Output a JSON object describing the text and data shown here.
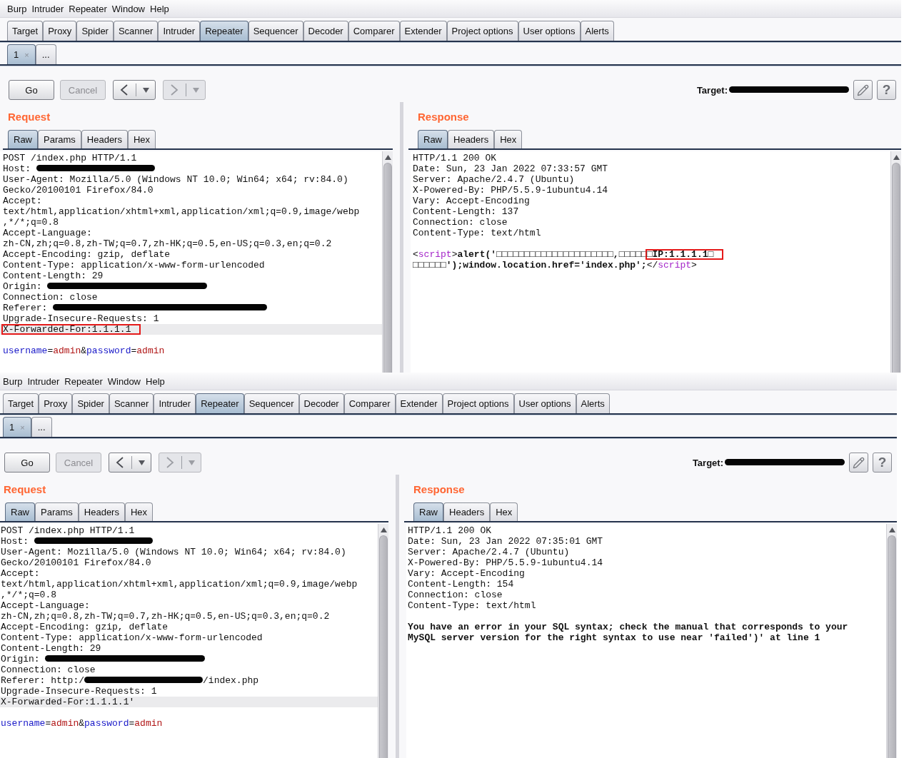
{
  "windows": [
    {
      "menu": [
        "Burp",
        "Intruder",
        "Repeater",
        "Window",
        "Help"
      ],
      "tabs": [
        {
          "label": "Target",
          "selected": false
        },
        {
          "label": "Proxy",
          "selected": false
        },
        {
          "label": "Spider",
          "selected": false
        },
        {
          "label": "Scanner",
          "selected": false
        },
        {
          "label": "Intruder",
          "selected": false
        },
        {
          "label": "Repeater",
          "selected": true
        },
        {
          "label": "Sequencer",
          "selected": false
        },
        {
          "label": "Decoder",
          "selected": false
        },
        {
          "label": "Comparer",
          "selected": false
        },
        {
          "label": "Extender",
          "selected": false
        },
        {
          "label": "Project options",
          "selected": false
        },
        {
          "label": "User options",
          "selected": false
        },
        {
          "label": "Alerts",
          "selected": false
        }
      ],
      "repeater_tabs": [
        {
          "label": "1",
          "close": "×",
          "selected": true
        },
        {
          "label": "...",
          "selected": false
        }
      ],
      "toolbar": {
        "buttons": [
          {
            "kind": "text",
            "label": "Go",
            "disabled": false
          },
          {
            "kind": "text",
            "label": "Cancel",
            "disabled": true
          },
          {
            "kind": "back",
            "disabled": false
          },
          {
            "kind": "forward",
            "disabled": true
          }
        ],
        "target": {
          "label": "Target:",
          "redacted": true
        },
        "help": "?"
      },
      "request": {
        "title": "Request",
        "tabs": [
          {
            "label": "Raw",
            "selected": true
          },
          {
            "label": "Params",
            "selected": false
          },
          {
            "label": "Headers",
            "selected": false
          },
          {
            "label": "Hex",
            "selected": false
          }
        ],
        "lines": [
          {
            "kind": "text",
            "highlighted": false,
            "parts": [
              {
                "kind": "plain",
                "text": "POST /index.php HTTP/1.1"
              }
            ]
          },
          {
            "kind": "text",
            "highlighted": false,
            "parts": [
              {
                "kind": "plain",
                "text": "Host: "
              },
              {
                "kind": "redaction-short"
              }
            ]
          },
          {
            "kind": "text",
            "highlighted": false,
            "parts": [
              {
                "kind": "plain",
                "text": "User-Agent: Mozilla/5.0 (Windows NT 10.0; Win64; x64; rv:84.0)"
              }
            ]
          },
          {
            "kind": "text",
            "highlighted": false,
            "parts": [
              {
                "kind": "plain",
                "text": "Gecko/20100101 Firefox/84.0"
              }
            ]
          },
          {
            "kind": "text",
            "highlighted": false,
            "parts": [
              {
                "kind": "plain",
                "text": "Accept:"
              }
            ]
          },
          {
            "kind": "text",
            "highlighted": false,
            "parts": [
              {
                "kind": "plain",
                "text": "text/html,application/xhtml+xml,application/xml;q=0.9,image/webp"
              }
            ]
          },
          {
            "kind": "text",
            "highlighted": false,
            "parts": [
              {
                "kind": "plain",
                "text": ",*/*;q=0.8"
              }
            ]
          },
          {
            "kind": "text",
            "highlighted": false,
            "parts": [
              {
                "kind": "plain",
                "text": "Accept-Language:"
              }
            ]
          },
          {
            "kind": "text",
            "highlighted": false,
            "parts": [
              {
                "kind": "plain",
                "text": "zh-CN,zh;q=0.8,zh-TW;q=0.7,zh-HK;q=0.5,en-US;q=0.3,en;q=0.2"
              }
            ]
          },
          {
            "kind": "text",
            "highlighted": false,
            "parts": [
              {
                "kind": "plain",
                "text": "Accept-Encoding: gzip, deflate"
              }
            ]
          },
          {
            "kind": "text",
            "highlighted": false,
            "parts": [
              {
                "kind": "plain",
                "text": "Content-Type: application/x-www-form-urlencoded"
              }
            ]
          },
          {
            "kind": "text",
            "highlighted": false,
            "parts": [
              {
                "kind": "plain",
                "text": "Content-Length: 29"
              }
            ]
          },
          {
            "kind": "text",
            "highlighted": false,
            "parts": [
              {
                "kind": "plain",
                "text": "Origin: "
              },
              {
                "kind": "redaction-medium"
              }
            ]
          },
          {
            "kind": "text",
            "highlighted": false,
            "parts": [
              {
                "kind": "plain",
                "text": "Connection: close"
              }
            ]
          },
          {
            "kind": "text",
            "highlighted": false,
            "parts": [
              {
                "kind": "plain",
                "text": "Referer: "
              },
              {
                "kind": "redaction-long"
              }
            ]
          },
          {
            "kind": "text",
            "highlighted": false,
            "parts": [
              {
                "kind": "plain",
                "text": "Upgrade-Insecure-Requests: 1"
              }
            ]
          },
          {
            "kind": "text",
            "highlighted": true,
            "parts": [
              {
                "kind": "boxed",
                "bold": false,
                "text": "X-Forwarded-For:1.1.1.1"
              }
            ]
          },
          {
            "kind": "blank",
            "highlighted": false
          },
          {
            "kind": "text",
            "highlighted": false,
            "parts": [
              {
                "kind": "name",
                "text": "username"
              },
              {
                "kind": "plain",
                "text": "="
              },
              {
                "kind": "value",
                "text": "admin"
              },
              {
                "kind": "plain",
                "text": "&"
              },
              {
                "kind": "name",
                "text": "password"
              },
              {
                "kind": "plain",
                "text": "="
              },
              {
                "kind": "value",
                "text": "admin"
              }
            ]
          }
        ]
      },
      "response": {
        "title": "Response",
        "tabs": [
          {
            "label": "Raw",
            "selected": true
          },
          {
            "label": "Headers",
            "selected": false
          },
          {
            "label": "Hex",
            "selected": false
          }
        ],
        "lines": [
          {
            "kind": "text",
            "highlighted": false,
            "parts": [
              {
                "kind": "plain",
                "text": "HTTP/1.1 200 OK"
              }
            ]
          },
          {
            "kind": "text",
            "highlighted": false,
            "parts": [
              {
                "kind": "plain",
                "text": "Date: Sun, 23 Jan 2022 07:33:57 GMT"
              }
            ]
          },
          {
            "kind": "text",
            "highlighted": false,
            "parts": [
              {
                "kind": "plain",
                "text": "Server: Apache/2.4.7 (Ubuntu)"
              }
            ]
          },
          {
            "kind": "text",
            "highlighted": false,
            "parts": [
              {
                "kind": "plain",
                "text": "X-Powered-By: PHP/5.5.9-1ubuntu4.14"
              }
            ]
          },
          {
            "kind": "text",
            "highlighted": false,
            "parts": [
              {
                "kind": "plain",
                "text": "Vary: Accept-Encoding"
              }
            ]
          },
          {
            "kind": "text",
            "highlighted": false,
            "parts": [
              {
                "kind": "plain",
                "text": "Content-Length: 137"
              }
            ]
          },
          {
            "kind": "text",
            "highlighted": false,
            "parts": [
              {
                "kind": "plain",
                "text": "Connection: close"
              }
            ]
          },
          {
            "kind": "text",
            "highlighted": false,
            "parts": [
              {
                "kind": "plain",
                "text": "Content-Type: text/html"
              }
            ]
          },
          {
            "kind": "blank",
            "highlighted": false
          },
          {
            "kind": "text",
            "highlighted": false,
            "parts": [
              {
                "kind": "plain",
                "text": "<"
              },
              {
                "kind": "tag",
                "text": "script"
              },
              {
                "kind": "plain",
                "text": ">"
              },
              {
                "kind": "bold",
                "text": "alert('□□□□□□□□□□□□□□□□□□□□□,□□□□□"
              },
              {
                "kind": "boxed",
                "bold": true,
                "text": "□IP:1.1.1.1□"
              }
            ]
          },
          {
            "kind": "text",
            "highlighted": false,
            "parts": [
              {
                "kind": "bold",
                "text": "□□□□□□');window.location.href='index.php';"
              },
              {
                "kind": "plain",
                "text": "</"
              },
              {
                "kind": "tag",
                "text": "script"
              },
              {
                "kind": "plain",
                "text": ">"
              }
            ]
          }
        ]
      }
    },
    {
      "menu": [
        "Burp",
        "Intruder",
        "Repeater",
        "Window",
        "Help"
      ],
      "tabs": [
        {
          "label": "Target",
          "selected": false
        },
        {
          "label": "Proxy",
          "selected": false
        },
        {
          "label": "Spider",
          "selected": false
        },
        {
          "label": "Scanner",
          "selected": false
        },
        {
          "label": "Intruder",
          "selected": false
        },
        {
          "label": "Repeater",
          "selected": true
        },
        {
          "label": "Sequencer",
          "selected": false
        },
        {
          "label": "Decoder",
          "selected": false
        },
        {
          "label": "Comparer",
          "selected": false
        },
        {
          "label": "Extender",
          "selected": false
        },
        {
          "label": "Project options",
          "selected": false
        },
        {
          "label": "User options",
          "selected": false
        },
        {
          "label": "Alerts",
          "selected": false
        }
      ],
      "repeater_tabs": [
        {
          "label": "1",
          "close": "×",
          "selected": true
        },
        {
          "label": "...",
          "selected": false
        }
      ],
      "toolbar": {
        "buttons": [
          {
            "kind": "text",
            "label": "Go",
            "disabled": false
          },
          {
            "kind": "text",
            "label": "Cancel",
            "disabled": true
          },
          {
            "kind": "back",
            "disabled": false
          },
          {
            "kind": "forward",
            "disabled": true
          }
        ],
        "target": {
          "label": "Target:",
          "redacted": true
        },
        "help": "?"
      },
      "request": {
        "title": "Request",
        "tabs": [
          {
            "label": "Raw",
            "selected": true
          },
          {
            "label": "Params",
            "selected": false
          },
          {
            "label": "Headers",
            "selected": false
          },
          {
            "label": "Hex",
            "selected": false
          }
        ],
        "lines": [
          {
            "kind": "text",
            "highlighted": false,
            "parts": [
              {
                "kind": "plain",
                "text": "POST /index.php HTTP/1.1"
              }
            ]
          },
          {
            "kind": "text",
            "highlighted": false,
            "parts": [
              {
                "kind": "plain",
                "text": "Host: "
              },
              {
                "kind": "redaction-short"
              }
            ]
          },
          {
            "kind": "text",
            "highlighted": false,
            "parts": [
              {
                "kind": "plain",
                "text": "User-Agent: Mozilla/5.0 (Windows NT 10.0; Win64; x64; rv:84.0)"
              }
            ]
          },
          {
            "kind": "text",
            "highlighted": false,
            "parts": [
              {
                "kind": "plain",
                "text": "Gecko/20100101 Firefox/84.0"
              }
            ]
          },
          {
            "kind": "text",
            "highlighted": false,
            "parts": [
              {
                "kind": "plain",
                "text": "Accept:"
              }
            ]
          },
          {
            "kind": "text",
            "highlighted": false,
            "parts": [
              {
                "kind": "plain",
                "text": "text/html,application/xhtml+xml,application/xml;q=0.9,image/webp"
              }
            ]
          },
          {
            "kind": "text",
            "highlighted": false,
            "parts": [
              {
                "kind": "plain",
                "text": ",*/*;q=0.8"
              }
            ]
          },
          {
            "kind": "text",
            "highlighted": false,
            "parts": [
              {
                "kind": "plain",
                "text": "Accept-Language:"
              }
            ]
          },
          {
            "kind": "text",
            "highlighted": false,
            "parts": [
              {
                "kind": "plain",
                "text": "zh-CN,zh;q=0.8,zh-TW;q=0.7,zh-HK;q=0.5,en-US;q=0.3,en;q=0.2"
              }
            ]
          },
          {
            "kind": "text",
            "highlighted": false,
            "parts": [
              {
                "kind": "plain",
                "text": "Accept-Encoding: gzip, deflate"
              }
            ]
          },
          {
            "kind": "text",
            "highlighted": false,
            "parts": [
              {
                "kind": "plain",
                "text": "Content-Type: application/x-www-form-urlencoded"
              }
            ]
          },
          {
            "kind": "text",
            "highlighted": false,
            "parts": [
              {
                "kind": "plain",
                "text": "Content-Length: 29"
              }
            ]
          },
          {
            "kind": "text",
            "highlighted": false,
            "parts": [
              {
                "kind": "plain",
                "text": "Origin: "
              },
              {
                "kind": "redaction-medium"
              }
            ]
          },
          {
            "kind": "text",
            "highlighted": false,
            "parts": [
              {
                "kind": "plain",
                "text": "Connection: close"
              }
            ]
          },
          {
            "kind": "text",
            "highlighted": false,
            "parts": [
              {
                "kind": "plain",
                "text": "Referer: http:/"
              },
              {
                "kind": "redaction-short"
              },
              {
                "kind": "plain",
                "text": "/index.php"
              }
            ]
          },
          {
            "kind": "text",
            "highlighted": false,
            "parts": [
              {
                "kind": "plain",
                "text": "Upgrade-Insecure-Requests: 1"
              }
            ]
          },
          {
            "kind": "text",
            "highlighted": true,
            "parts": [
              {
                "kind": "plain",
                "text": "X-Forwarded-For:1.1.1.1'"
              }
            ]
          },
          {
            "kind": "blank",
            "highlighted": false
          },
          {
            "kind": "text",
            "highlighted": false,
            "parts": [
              {
                "kind": "name",
                "text": "username"
              },
              {
                "kind": "plain",
                "text": "="
              },
              {
                "kind": "value",
                "text": "admin"
              },
              {
                "kind": "plain",
                "text": "&"
              },
              {
                "kind": "name",
                "text": "password"
              },
              {
                "kind": "plain",
                "text": "="
              },
              {
                "kind": "value",
                "text": "admin"
              }
            ]
          }
        ]
      },
      "response": {
        "title": "Response",
        "tabs": [
          {
            "label": "Raw",
            "selected": true
          },
          {
            "label": "Headers",
            "selected": false
          },
          {
            "label": "Hex",
            "selected": false
          }
        ],
        "lines": [
          {
            "kind": "text",
            "highlighted": false,
            "parts": [
              {
                "kind": "plain",
                "text": "HTTP/1.1 200 OK"
              }
            ]
          },
          {
            "kind": "text",
            "highlighted": false,
            "parts": [
              {
                "kind": "plain",
                "text": "Date: Sun, 23 Jan 2022 07:35:01 GMT"
              }
            ]
          },
          {
            "kind": "text",
            "highlighted": false,
            "parts": [
              {
                "kind": "plain",
                "text": "Server: Apache/2.4.7 (Ubuntu)"
              }
            ]
          },
          {
            "kind": "text",
            "highlighted": false,
            "parts": [
              {
                "kind": "plain",
                "text": "X-Powered-By: PHP/5.5.9-1ubuntu4.14"
              }
            ]
          },
          {
            "kind": "text",
            "highlighted": false,
            "parts": [
              {
                "kind": "plain",
                "text": "Vary: Accept-Encoding"
              }
            ]
          },
          {
            "kind": "text",
            "highlighted": false,
            "parts": [
              {
                "kind": "plain",
                "text": "Content-Length: 154"
              }
            ]
          },
          {
            "kind": "text",
            "highlighted": false,
            "parts": [
              {
                "kind": "plain",
                "text": "Connection: close"
              }
            ]
          },
          {
            "kind": "text",
            "highlighted": false,
            "parts": [
              {
                "kind": "plain",
                "text": "Content-Type: text/html"
              }
            ]
          },
          {
            "kind": "blank",
            "highlighted": false
          },
          {
            "kind": "text",
            "highlighted": false,
            "parts": [
              {
                "kind": "bold",
                "text": "You have an error in your SQL syntax; check the manual that corresponds to your"
              }
            ]
          },
          {
            "kind": "text",
            "highlighted": false,
            "parts": [
              {
                "kind": "bold",
                "text": "MySQL server version for the right syntax to use near 'failed')' at line 1"
              }
            ]
          }
        ]
      }
    }
  ]
}
